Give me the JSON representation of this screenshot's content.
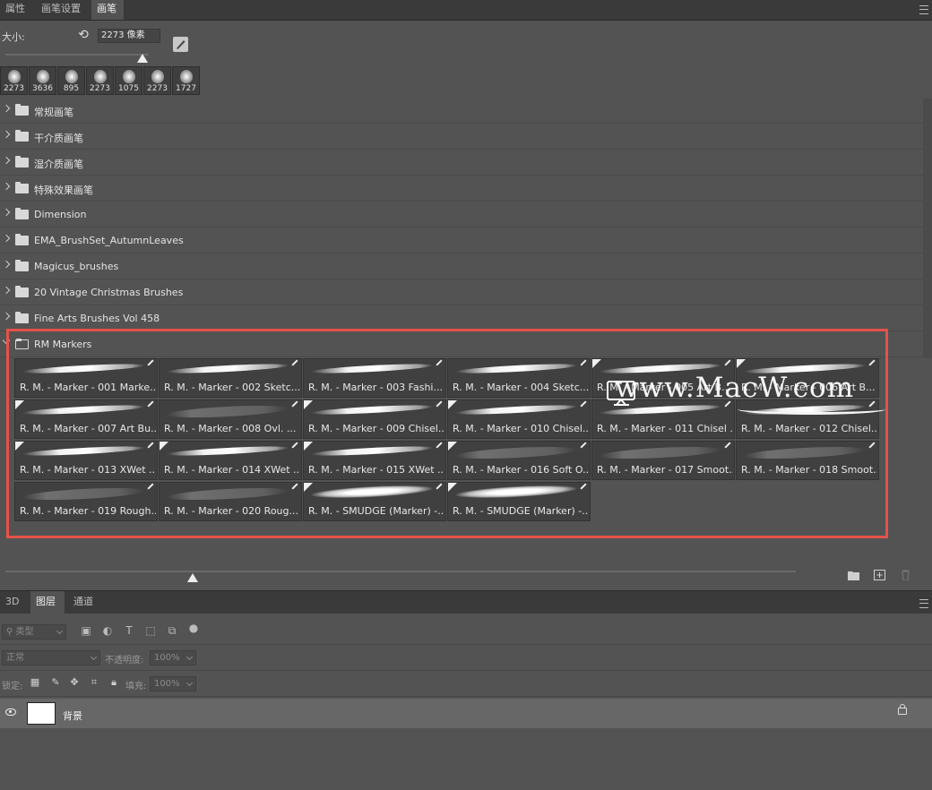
{
  "brush_panel": {
    "tabs": [
      "属性",
      "画笔设置",
      "画笔"
    ],
    "active_tab": "画笔",
    "size_label": "大小:",
    "size_value": "2273 像素",
    "size_slider_fraction": 0.95,
    "recent_brushes": [
      "2273",
      "3636",
      "895",
      "2273",
      "1075",
      "2273",
      "1727"
    ],
    "groups": [
      "常规画笔",
      "干介质画笔",
      "湿介质画笔",
      "特殊效果画笔",
      "Dimension",
      "EMA_BrushSet_AutumnLeaves",
      "Magicus_brushes",
      "20 Vintage Christmas Brushes",
      "Fine Arts Brushes Vol 458",
      "RM Markers"
    ],
    "open_group": "RM Markers",
    "marker_brushes": [
      {
        "name": "R. M. - Marker - 001 Marke...",
        "style": "hard",
        "badge": false
      },
      {
        "name": "R. M. - Marker - 002 Sketc...",
        "style": "hard",
        "badge": false
      },
      {
        "name": "R. M. - Marker - 003 Fashi...",
        "style": "hard",
        "badge": false
      },
      {
        "name": "R. M. - Marker - 004 Sketc...",
        "style": "hard",
        "badge": false
      },
      {
        "name": "R. M. - Marker - 005 Art B...",
        "style": "hard",
        "badge": true
      },
      {
        "name": "R. M. - Marker - 006 Art B...",
        "style": "hard",
        "badge": true
      },
      {
        "name": "R. M. - Marker - 007 Art Bu...",
        "style": "hard",
        "badge": true
      },
      {
        "name": "R. M. - Marker - 008 Ovl. ...",
        "style": "soft",
        "badge": false
      },
      {
        "name": "R. M. - Marker - 009 Chisel...",
        "style": "hard",
        "badge": true
      },
      {
        "name": "R. M. - Marker - 010 Chisel...",
        "style": "hard",
        "badge": true
      },
      {
        "name": "R. M. - Marker - 011 Chisel ...",
        "style": "hard",
        "badge": false
      },
      {
        "name": "R. M. - Marker - 012 Chisel...",
        "style": "hard",
        "badge": false
      },
      {
        "name": "R. M. - Marker - 013 XWet ...",
        "style": "hard",
        "badge": true
      },
      {
        "name": "R. M. - Marker - 014 XWet ...",
        "style": "hard",
        "badge": true
      },
      {
        "name": "R. M. - Marker - 015 XWet ...",
        "style": "hard",
        "badge": true
      },
      {
        "name": "R. M. - Marker - 016 Soft O...",
        "style": "soft",
        "badge": true
      },
      {
        "name": "R. M. - Marker - 017 Smoot...",
        "style": "soft",
        "badge": false
      },
      {
        "name": "R. M. - Marker - 018 Smoot...",
        "style": "soft",
        "badge": false
      },
      {
        "name": "R. M. - Marker - 019 Rough...",
        "style": "soft",
        "badge": false
      },
      {
        "name": "R. M. - Marker - 020 Roug...",
        "style": "soft",
        "badge": false
      },
      {
        "name": "R. M. - SMUDGE (Marker) -...",
        "style": "smudge",
        "badge": true
      },
      {
        "name": "R. M. - SMUDGE (Marker) -...",
        "style": "smudge",
        "badge": true
      }
    ],
    "watermark": "www.MacW.com",
    "thumb_size_fraction": 0.23,
    "highlight_color": "#e5524a"
  },
  "layers_panel": {
    "tabs": [
      "3D",
      "图层",
      "通道"
    ],
    "active_tab": "图层",
    "filter_placeholder": "类型",
    "blend_mode": "正常",
    "opacity_label": "不透明度:",
    "opacity_value": "100%",
    "lock_label": "锁定:",
    "fill_label": "填充:",
    "fill_value": "100%",
    "layer": {
      "name": "背景",
      "visible": true,
      "locked": true
    }
  }
}
